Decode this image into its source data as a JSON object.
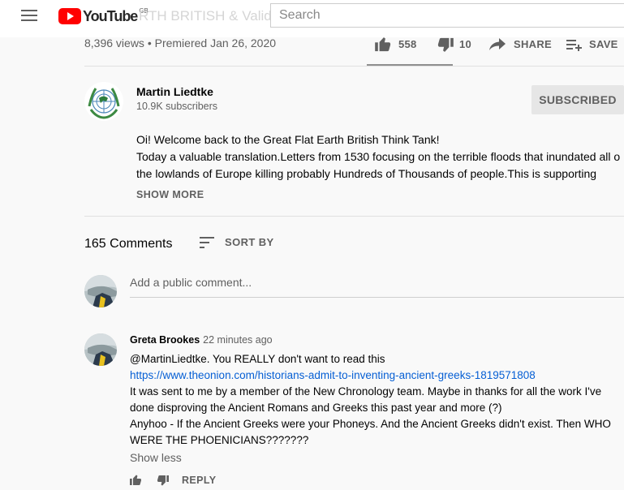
{
  "masthead": {
    "logo_text": "YouTube",
    "region": "GB",
    "ghost_title": "RTH BRITISH & Valid...",
    "search_placeholder": "Search"
  },
  "video": {
    "meta": "8,396 views • Premiered Jan 26, 2020",
    "likes": "558",
    "dislikes": "10",
    "share_label": "SHARE",
    "save_label": "SAVE",
    "like_ratio": 0.98
  },
  "channel": {
    "name": "Martin Liedtke",
    "subscribers": "10.9K subscribers",
    "subscribe_label": "SUBSCRIBED"
  },
  "description": {
    "line1": "Oi! Welcome back to the Great Flat Earth British Think Tank!",
    "line2": "Today a valuable translation.Letters from 1530 focusing on the terrible floods that inundated all o",
    "line3": "the lowlands of Europe killing probably Hundreds of Thousands of people.This is supporting",
    "show_more": "SHOW MORE"
  },
  "comments": {
    "count": "165 Comments",
    "sort_label": "SORT BY",
    "add_placeholder": "Add a public comment...",
    "items": [
      {
        "author": "Greta Brookes",
        "time": "22 minutes ago",
        "line1": "@MartinLiedtke. You REALLY don't want to read this",
        "link": "https://www.theonion.com/historians-admit-to-inventing-ancient-greeks-1819571808",
        "line3": "It was sent to me by a member of the New Chronology team. Maybe in thanks for all the work I've",
        "line4": "done disproving the Ancient Romans and Greeks this past year and more (?)",
        "line5": "Anyhoo - If the Ancient Greeks were your Phoneys. And the Ancient Greeks didn't exist. Then WHO",
        "line6": "WERE THE PHOENICIANS???????",
        "show_less": "Show less",
        "reply_label": "REPLY"
      }
    ]
  },
  "colors": {
    "accent_link": "#065fd4",
    "brand_red": "#ff0000",
    "muted_text": "#606060"
  }
}
